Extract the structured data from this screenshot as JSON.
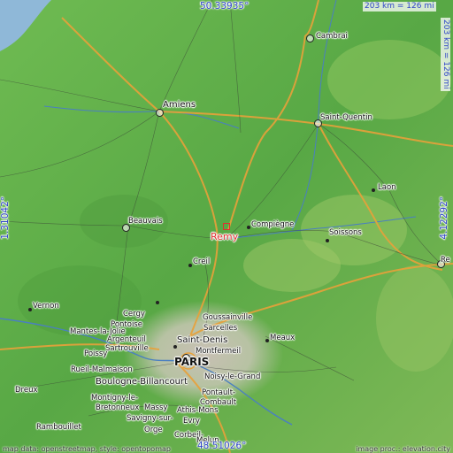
{
  "map": {
    "coords": {
      "top": "50.33935°",
      "bottom": "48.51026°",
      "left": "1.31042°",
      "right": "4.12292°"
    },
    "scale": {
      "horizontal": "203 km = 126 mi",
      "vertical": "203 km = 126 mi"
    },
    "footer": {
      "left": "map data: openstreetmap, style: opentopomap",
      "right": "image proc.: elevation.city"
    },
    "highlight": "Remy",
    "cities": {
      "cambrai": "Cambrai",
      "amiens": "Amiens",
      "saint_quentin": "Saint-Quentin",
      "laon": "Laon",
      "beauvais": "Beauvais",
      "compiegne": "Compiègne",
      "soissons": "Soissons",
      "creil": "Creil",
      "reims": "Re",
      "vernon": "Vernon",
      "cergy": "Cergy",
      "pontoise": "Pontoise",
      "mantes": "Mantes-la-Jolie",
      "poissy": "Poissy",
      "argenteuil": "Argenteuil",
      "sartrouville": "Sartrouville",
      "goussainville": "Goussainville",
      "sarcelles": "Sarcelles",
      "saint_denis": "Saint-Denis",
      "meaux": "Meaux",
      "montfermeil": "Montfermeil",
      "rueil": "Rueil-Malmaison",
      "paris": "PARIS",
      "boulogne": "Boulogne-Billancourt",
      "noisy": "Noisy-le-Grand",
      "dreux": "Dreux",
      "montigny": "Montigny-le-",
      "bretonneux": "Bretonneux",
      "massy": "Massy",
      "pontault": "Pontault-",
      "combault": "Combault",
      "athis": "Athis-Mons",
      "savigny": "Savigny-sur-",
      "evry": "Evry",
      "rambouillet": "Rambouillet",
      "orge": "Orge",
      "corbeil": "Corbeil-",
      "melun": "Melun"
    }
  }
}
